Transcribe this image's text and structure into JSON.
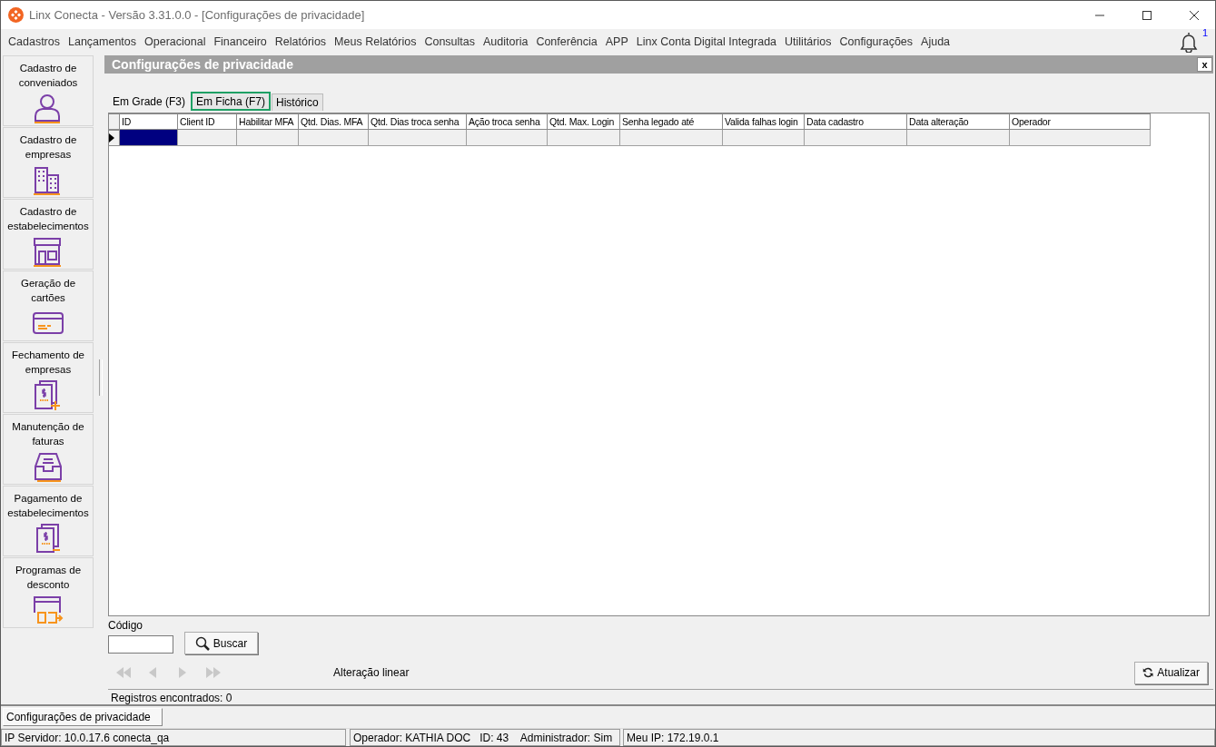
{
  "window": {
    "title": "Linx Conecta - Versão 3.31.0.0 - [Configurações de privacidade]"
  },
  "menu": [
    "Cadastros",
    "Lançamentos",
    "Operacional",
    "Financeiro",
    "Relatórios",
    "Meus Relatórios",
    "Consultas",
    "Auditoria",
    "Conferência",
    "APP",
    "Linx Conta Digital Integrada",
    "Utilitários",
    "Configurações",
    "Ajuda"
  ],
  "notifications": {
    "count": "1"
  },
  "sidebar": {
    "items": [
      {
        "label": "Cadastro de conveniados"
      },
      {
        "label": "Cadastro de empresas"
      },
      {
        "label": "Cadastro de estabelecimentos"
      },
      {
        "label": "Geração de cartões"
      },
      {
        "label": "Fechamento de empresas"
      },
      {
        "label": "Manutenção de faturas"
      },
      {
        "label": "Pagamento de estabelecimentos"
      },
      {
        "label": "Programas de desconto"
      }
    ]
  },
  "panel": {
    "title": "Configurações de privacidade",
    "close": "x",
    "tabs": [
      {
        "label": "Em Grade (F3)",
        "selected": true,
        "focused": false
      },
      {
        "label": "Em Ficha (F7)",
        "selected": false,
        "focused": true
      },
      {
        "label": "Histórico",
        "selected": false,
        "focused": false
      }
    ],
    "table": {
      "columns": [
        "ID",
        "Client ID",
        "Habilitar MFA",
        "Qtd. Dias. MFA",
        "Qtd. Dias troca senha",
        "Ação troca senha",
        "Qtd. Max. Login",
        "Senha legado até",
        "Valida falhas login",
        "Data cadastro",
        "Data alteração",
        "Operador"
      ],
      "rows": [
        {
          "selected": true
        }
      ]
    },
    "code_label": "Código",
    "search_button": "Buscar",
    "nav": [
      {
        "disabled": true
      },
      {
        "disabled": true
      },
      {
        "disabled": true
      },
      {
        "disabled": true
      }
    ],
    "linear_edit": "Alteração linear",
    "refresh_button": "Atualizar",
    "records": "Registros encontrados: 0"
  },
  "open_windows": [
    {
      "label": "Configurações de privacidade",
      "selected": true
    }
  ],
  "status_bar": [
    "IP Servidor: 10.0.17.6 conecta_qa",
    "Operador: KATHIA DOC   ID: 43    Administrador: Sim",
    "Meu IP: 172.19.0.1"
  ]
}
